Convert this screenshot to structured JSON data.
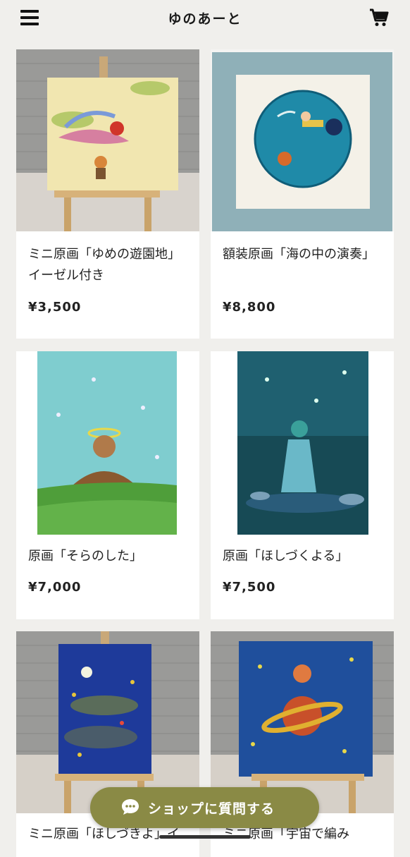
{
  "header": {
    "title": "ゆのあーと"
  },
  "products": [
    {
      "name": "ミニ原画「ゆめの遊園地」イーゼル付き",
      "price": "¥3,500"
    },
    {
      "name": "額装原画「海の中の演奏」",
      "price": "¥8,800"
    },
    {
      "name": "原画「そらのした」",
      "price": "¥7,000"
    },
    {
      "name": "原画「ほしづくよる」",
      "price": "¥7,500"
    },
    {
      "name": "ミニ原画「ほしづきよ」イ",
      "price": ""
    },
    {
      "name": "ミニ原画「宇宙で編み",
      "price": ""
    }
  ],
  "faq_button": {
    "label": "ショップに質問する"
  },
  "colors": {
    "background": "#f0efec",
    "card": "#ffffff",
    "accent": "#8a8a45"
  }
}
